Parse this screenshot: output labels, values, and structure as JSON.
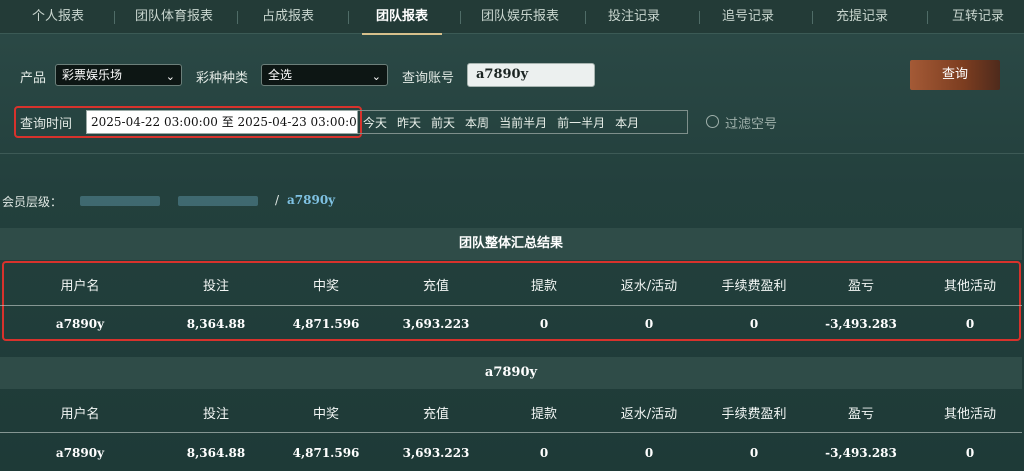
{
  "tabs": [
    {
      "label": "个人报表"
    },
    {
      "label": "团队体育报表"
    },
    {
      "label": "占成报表"
    },
    {
      "label": "团队报表"
    },
    {
      "label": "团队娱乐报表"
    },
    {
      "label": "投注记录"
    },
    {
      "label": "追号记录"
    },
    {
      "label": "充提记录"
    },
    {
      "label": "互转记录"
    }
  ],
  "filters": {
    "product_label": "产品",
    "product_value": "彩票娱乐场",
    "lottery_type_label": "彩种种类",
    "lottery_type_value": "全选",
    "account_label": "查询账号",
    "account_value": "a7890y",
    "query_button": "查询",
    "time_label": "查询时间",
    "date_range": "2025-04-22 03:00:00 至 2025-04-23 03:00:00",
    "quick_ranges": [
      "今天",
      "昨天",
      "前天",
      "本周",
      "当前半月",
      "前一半月",
      "本月"
    ],
    "filter_empty_label": "过滤空号"
  },
  "member": {
    "label": "会员层级：",
    "separator": "/",
    "current": "a7890y"
  },
  "summary": {
    "title": "团队整体汇总结果",
    "headers": [
      "用户名",
      "投注",
      "中奖",
      "充值",
      "提款",
      "返水/活动",
      "手续费盈利",
      "盈亏",
      "其他活动"
    ],
    "row": [
      "a7890y",
      "8,364.88",
      "4,871.596",
      "3,693.223",
      "0",
      "0",
      "0",
      "-3,493.283",
      "0"
    ]
  },
  "detail": {
    "title": "a7890y",
    "headers": [
      "用户名",
      "投注",
      "中奖",
      "充值",
      "提款",
      "返水/活动",
      "手续费盈利",
      "盈亏",
      "其他活动"
    ],
    "row": [
      "a7890y",
      "8,364.88",
      "4,871.596",
      "3,693.223",
      "0",
      "0",
      "0",
      "-3,493.283",
      "0"
    ]
  },
  "colors": {
    "highlight_red": "#d8322c",
    "active_tab_underline": "#d7c08c",
    "query_button": "#a45a36"
  }
}
